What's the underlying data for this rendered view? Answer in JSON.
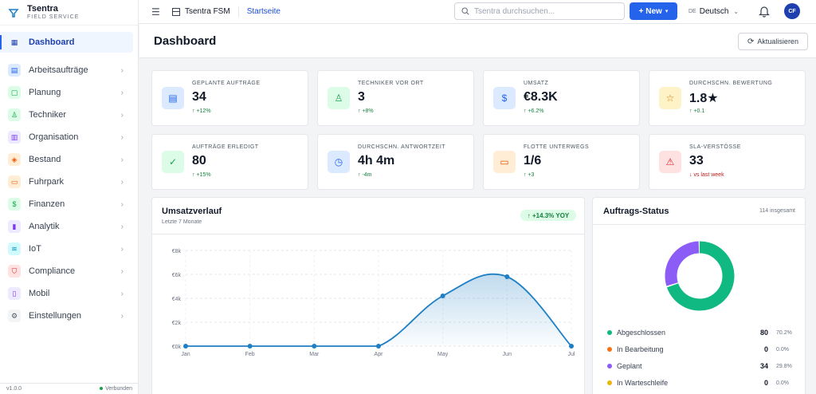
{
  "brand": {
    "name": "Tsentra",
    "sub": "FIELD SERVICE"
  },
  "sidebar": {
    "items": [
      {
        "label": "Dashboard",
        "icon": "grid-icon",
        "active": true
      },
      {
        "label": "Arbeitsaufträge",
        "icon": "clipboard-icon"
      },
      {
        "label": "Planung",
        "icon": "calendar-icon"
      },
      {
        "label": "Techniker",
        "icon": "user-check-icon"
      },
      {
        "label": "Organisation",
        "icon": "building-icon"
      },
      {
        "label": "Bestand",
        "icon": "box-icon"
      },
      {
        "label": "Fuhrpark",
        "icon": "truck-icon"
      },
      {
        "label": "Finanzen",
        "icon": "dollar-icon"
      },
      {
        "label": "Analytik",
        "icon": "bar-chart-icon"
      },
      {
        "label": "IoT",
        "icon": "wifi-icon"
      },
      {
        "label": "Compliance",
        "icon": "shield-icon"
      },
      {
        "label": "Mobil",
        "icon": "smartphone-icon"
      },
      {
        "label": "Einstellungen",
        "icon": "gear-icon"
      }
    ],
    "version": "v1.0.0",
    "connection": "Verbunden"
  },
  "topbar": {
    "app": "Tsentra FSM",
    "breadcrumb": "Startseite",
    "search_placeholder": "Tsentra durchsuchen...",
    "new_label": "+ New",
    "lang_code": "DE",
    "lang": "Deutsch",
    "avatar": "CF"
  },
  "header": {
    "title": "Dashboard",
    "refresh": "Aktualisieren"
  },
  "kpis": [
    {
      "label": "Geplante Aufträge",
      "value": "34",
      "delta": "↑ +12%"
    },
    {
      "label": "Techniker vor Ort",
      "value": "3",
      "delta": "↑ +8%"
    },
    {
      "label": "Umsatz",
      "value": "€8.3K",
      "delta": "↑ +6.2%"
    },
    {
      "label": "Durchschn. Bewertung",
      "value": "1.8★",
      "delta": "↑ +0.1"
    },
    {
      "label": "Aufträge erledigt",
      "value": "80",
      "delta": "↑ +15%"
    },
    {
      "label": "Durchschn. Antwortzeit",
      "value": "4h 4m",
      "delta": "↑ -4m"
    },
    {
      "label": "Flotte unterwegs",
      "value": "1/6",
      "delta": "↑ +3"
    },
    {
      "label": "SLA-Verstöße",
      "value": "33",
      "delta": "↓ vs last week"
    }
  ],
  "revenue": {
    "title": "Umsatzverlauf",
    "subtitle": "Letzte 7 Monate",
    "badge": "↑ +14.3% YOY"
  },
  "status": {
    "title": "Auftrags-Status",
    "total": "114 insgesamt",
    "items": [
      {
        "name": "Abgeschlossen",
        "count": "80",
        "pct": "70.2%",
        "color": "#10b981"
      },
      {
        "name": "In Bearbeitung",
        "count": "0",
        "pct": "0.0%",
        "color": "#f97316"
      },
      {
        "name": "Geplant",
        "count": "34",
        "pct": "29.8%",
        "color": "#8b5cf6"
      },
      {
        "name": "In Warteschleife",
        "count": "0",
        "pct": "0.0%",
        "color": "#eab308"
      }
    ]
  },
  "chart_data": {
    "type": "area",
    "title": "Umsatzverlauf",
    "categories": [
      "Jan",
      "Feb",
      "Mar",
      "Apr",
      "May",
      "Jun",
      "Jul"
    ],
    "values": [
      0,
      0,
      0,
      0,
      4200,
      5800,
      0
    ],
    "yticks": [
      "€0k",
      "€2k",
      "€4k",
      "€6k",
      "€8k"
    ],
    "ylim": [
      0,
      8000
    ],
    "color": "#1e7fc4",
    "grid": true
  }
}
